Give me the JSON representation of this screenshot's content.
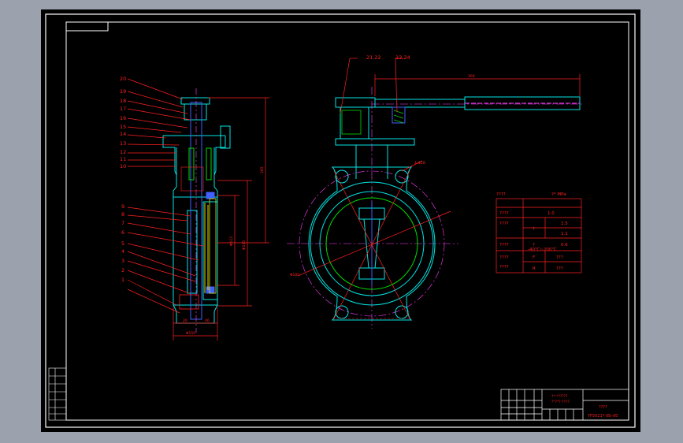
{
  "colors": {
    "background": "#9ba1ad",
    "paper": "#000000",
    "frame": "#ffffff",
    "body_outline": "#00e5e5",
    "dimension": "#ff2020",
    "centerline": "#ff40ff",
    "hidden": "#4060ff",
    "green": "#00dd00",
    "yellow": "#e0e000"
  },
  "side_view": {
    "balloons": [
      "20",
      "19",
      "18",
      "17",
      "16",
      "15",
      "14",
      "13",
      "12",
      "11",
      "10",
      "9",
      "8",
      "7",
      "6",
      "5",
      "4",
      "3",
      "2",
      "1"
    ],
    "dim_overall": "265",
    "dim_d1": "Φ112",
    "dim_d2": "Φ145",
    "dim_bottom": "Φ150",
    "dim_b1": "20",
    "dim_b2": "46"
  },
  "front_view": {
    "balloon_a": "21,22",
    "balloon_b": "23,24",
    "dim_handle": "160",
    "dim_bolt": "4-Φ18",
    "dim_circle": "Φ185"
  },
  "spec_table": {
    "header_left": "????",
    "header_right": "?*  MPa",
    "rows": [
      {
        "c1": "????",
        "c2": "",
        "c3": "1.0"
      },
      {
        "c1": "????",
        "c2": "?",
        "c3": "1.5"
      },
      {
        "c1": "",
        "c2": "",
        "c3": "1.1"
      },
      {
        "c1": "????",
        "c2": "?",
        "c3": "0.6"
      },
      {
        "c1": "????",
        "c2": "-40℃~200℃",
        "c3": ""
      },
      {
        "c1": "????",
        "c2": "F",
        "c3": "???"
      },
      {
        "c1": "",
        "c2": "R",
        "c3": "???"
      }
    ]
  },
  "title_block": {
    "company_line1": "?*-*?????",
    "company_line2": "?*?*?-????",
    "name": "????",
    "code": "YF5021*-(B)-00"
  }
}
